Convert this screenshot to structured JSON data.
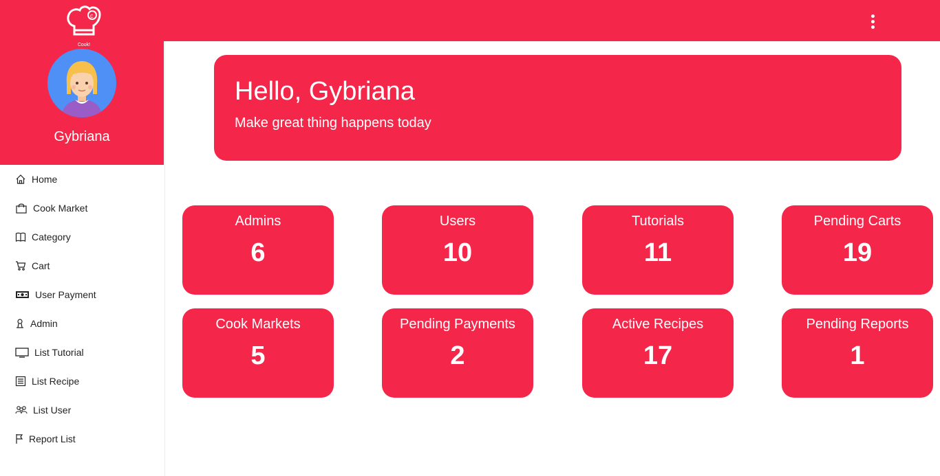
{
  "app": {
    "logo_text": "Cook!",
    "username": "Gybriana"
  },
  "icons": {
    "menu": "more-vert-icon",
    "logo": "chef-hat-logo",
    "avatar": "user-avatar"
  },
  "colors": {
    "primary": "#f4274a",
    "text": "#222222",
    "background": "#ffffff"
  },
  "sidebar": {
    "items": [
      {
        "label": "Home",
        "icon": "home-icon"
      },
      {
        "label": "Cook Market",
        "icon": "shopping-bag-icon"
      },
      {
        "label": "Category",
        "icon": "book-icon"
      },
      {
        "label": "Cart",
        "icon": "cart-icon"
      },
      {
        "label": "User Payment",
        "icon": "cash-icon"
      },
      {
        "label": "Admin",
        "icon": "person-icon"
      },
      {
        "label": "List Tutorial",
        "icon": "monitor-icon"
      },
      {
        "label": "List Recipe",
        "icon": "list-icon"
      },
      {
        "label": "List User",
        "icon": "people-icon"
      },
      {
        "label": "Report List",
        "icon": "flag-icon"
      }
    ]
  },
  "hero": {
    "title": "Hello, Gybriana",
    "subtitle": "Make great thing happens today"
  },
  "stats": [
    {
      "label": "Admins",
      "value": "6"
    },
    {
      "label": "Users",
      "value": "10"
    },
    {
      "label": "Tutorials",
      "value": "11"
    },
    {
      "label": "Pending Carts",
      "value": "19"
    },
    {
      "label": "Cook Markets",
      "value": "5"
    },
    {
      "label": "Pending Payments",
      "value": "2"
    },
    {
      "label": "Active Recipes",
      "value": "17"
    },
    {
      "label": "Pending Reports",
      "value": "1"
    }
  ]
}
